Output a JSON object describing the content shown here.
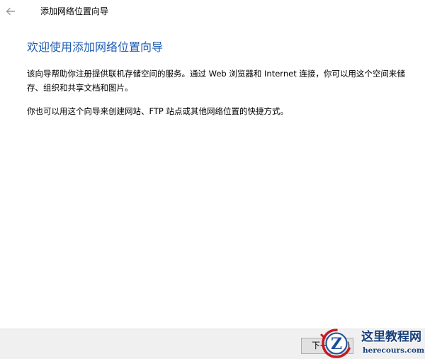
{
  "window": {
    "title": "添加网络位置向导",
    "back_icon": "back-arrow-icon"
  },
  "main": {
    "heading": "欢迎使用添加网络位置向导",
    "paragraph_1": "该向导帮助你注册提供联机存储空间的服务。通过 Web 浏览器和 Internet 连接，你可以用这个空间来储存、组织和共享文档和图片。",
    "paragraph_2": "你也可以用这个向导来创建网站、FTP 站点或其他网络位置的快捷方式。"
  },
  "footer": {
    "next_label": "下一步(N)"
  },
  "watermark": {
    "title": "这里教程网",
    "url": "herecours.com",
    "logo_letter": "Z"
  },
  "colors": {
    "heading": "#1c5bb3",
    "footer_background": "#f0f0f0",
    "watermark_text": "#163e7a",
    "watermark_logo_red": "#c8191f",
    "watermark_logo_blue": "#1d4f9c"
  }
}
